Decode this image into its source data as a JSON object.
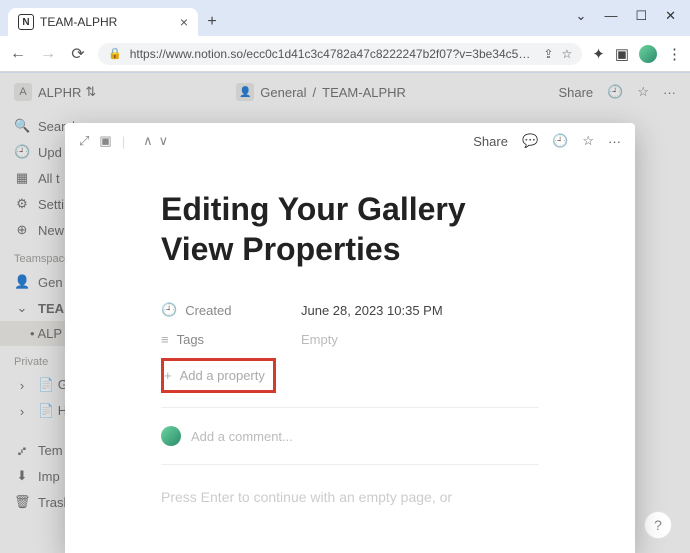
{
  "browser": {
    "tab_title": "TEAM-ALPHR",
    "url": "https://www.notion.so/ecc0c1d41c3c4782a47c8222247b2f07?v=3be34c57d3...",
    "window_controls": {
      "min": "—",
      "max": "☐",
      "close": "✕",
      "chevron": "⌄"
    }
  },
  "workspace": {
    "name": "ALPHR",
    "chevron": "⇅"
  },
  "breadcrumb": {
    "parent": "General",
    "sep": "/",
    "current": "TEAM-ALPHR"
  },
  "topbar": {
    "share": "Share",
    "clock": "🕘",
    "star": "☆",
    "more": "···"
  },
  "sidebar": {
    "items": [
      {
        "icon": "🔍",
        "label": "Search"
      },
      {
        "icon": "🕘",
        "label": "Upd"
      },
      {
        "icon": "▦",
        "label": "All t"
      },
      {
        "icon": "⚙",
        "label": "Setti"
      },
      {
        "icon": "⊕",
        "label": "New"
      }
    ],
    "section_teamspaces": "Teamspaces",
    "teamspace_items": [
      {
        "icon": "👤",
        "label": "Gen"
      },
      {
        "icon": "▸",
        "label": "TEA",
        "active": true
      },
      {
        "icon": "",
        "label": "• ALP",
        "sub": true
      }
    ],
    "section_private": "Private",
    "private_items": [
      {
        "icon": "›",
        "label": "📄 Ge"
      },
      {
        "icon": "›",
        "label": "📄 Ho"
      }
    ],
    "bottom_items": [
      {
        "icon": "⑇",
        "label": "Tem"
      },
      {
        "icon": "⬇",
        "label": "Imp"
      },
      {
        "icon": "🗑",
        "label": "Trasl"
      }
    ]
  },
  "modal": {
    "top": {
      "expand": "⤢",
      "peek": "▣",
      "up": "∧",
      "down": "∨",
      "share": "Share",
      "comments": "💬",
      "clock": "🕘",
      "star": "☆",
      "more": "···"
    },
    "title": "Editing Your Gallery View Properties",
    "properties": [
      {
        "icon": "🕘",
        "label": "Created",
        "value": "June 28, 2023 10:35 PM",
        "empty": false
      },
      {
        "icon": "≡",
        "label": "Tags",
        "value": "Empty",
        "empty": true
      }
    ],
    "add_property": {
      "icon": "+",
      "label": "Add a property"
    },
    "comment_placeholder": "Add a comment...",
    "empty_hint": "Press Enter to continue with an empty page, or"
  },
  "behind": {
    "row_title": "Editing Your Gallery View Properties",
    "help": "?"
  }
}
